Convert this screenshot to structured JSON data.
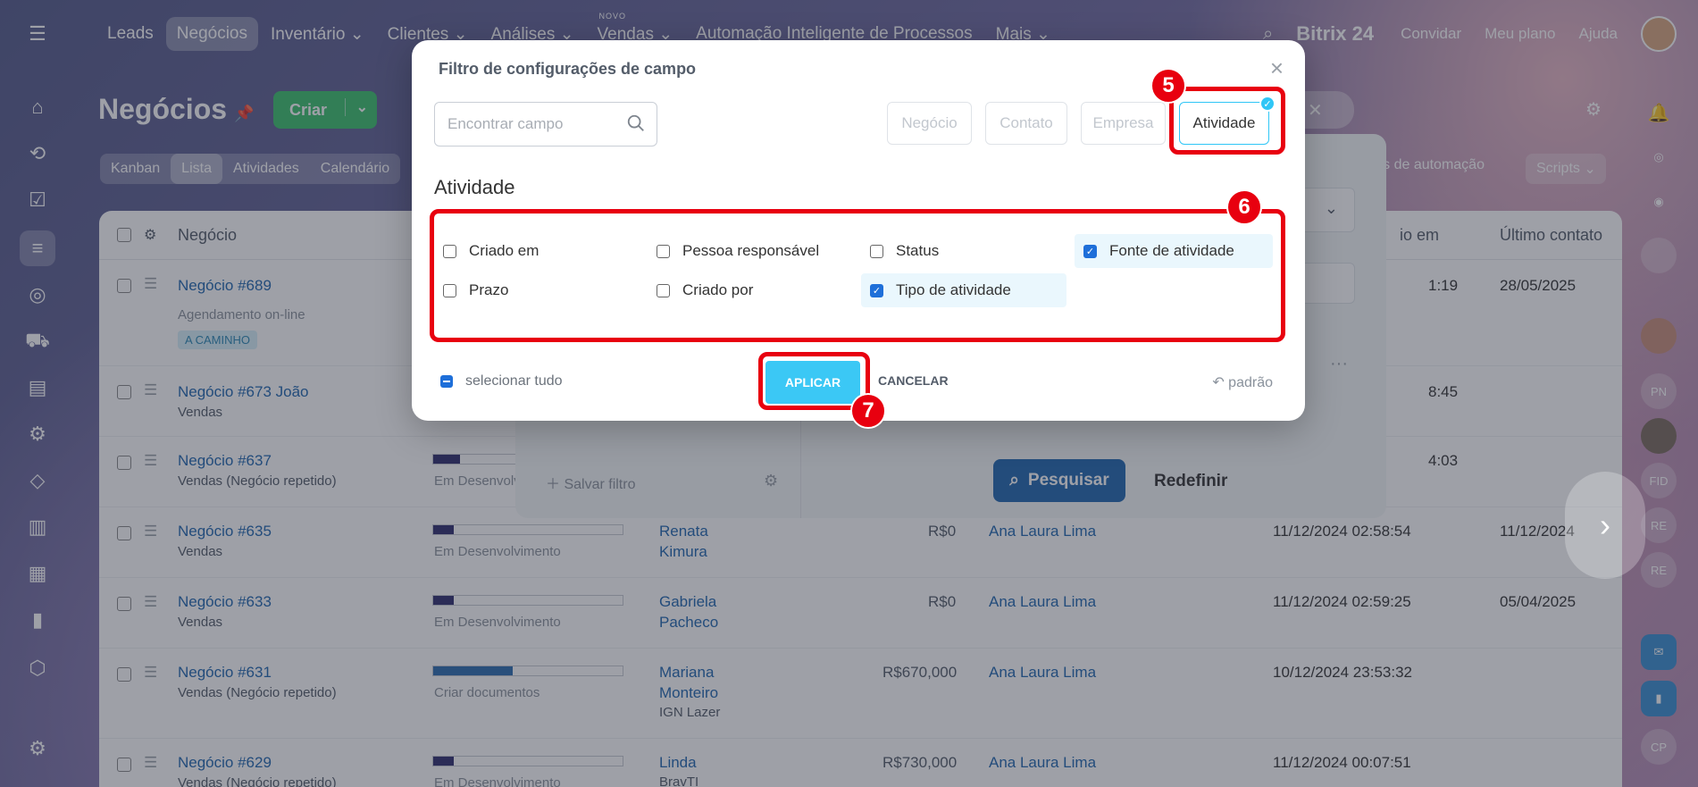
{
  "topnav": {
    "items": [
      {
        "label": "Leads",
        "active": false
      },
      {
        "label": "Negócios",
        "active": true
      },
      {
        "label": "Inventário",
        "active": false
      },
      {
        "label": "Clientes",
        "active": false
      },
      {
        "label": "Análises",
        "active": false
      },
      {
        "label": "Vendas",
        "active": false,
        "badge": "NOVO"
      },
      {
        "label": "Automação Inteligente de Processos",
        "active": false
      },
      {
        "label": "Mais",
        "active": false
      }
    ],
    "brand": "Bitrix 24",
    "invite": "Convidar",
    "plan": "Meu plano",
    "help": "Ajuda"
  },
  "page": {
    "title": "Negócios",
    "create_label": "Criar",
    "view_tabs": [
      "Kanban",
      "Lista",
      "Atividades",
      "Calendário"
    ],
    "active_view": "Lista",
    "automation_label": "gras de automação",
    "scripts_label": "Scripts"
  },
  "list": {
    "columns": [
      "Negócio",
      "io em",
      "Último contato"
    ],
    "rows": [
      {
        "title": "Negócio #689",
        "subtitle": "Agendamento on-line",
        "badge": "A CAMINHO",
        "time": "1:19",
        "last_contact": "28/05/2025"
      },
      {
        "title": "Negócio #673 João",
        "subtitle": "Vendas",
        "time": "8:45",
        "last_contact": ""
      },
      {
        "title": "Negócio #637",
        "subtitle": "Vendas (Negócio repetido)",
        "stage": "Em Desenvolvi",
        "time": "4:03",
        "last_contact": ""
      },
      {
        "title": "Negócio #635",
        "subtitle": "Vendas",
        "stage": "Em Desenvolvimento",
        "contact_line1": "Renata",
        "contact_line2": "Kimura",
        "amount": "R$0",
        "responsible": "Ana Laura Lima",
        "created": "11/12/2024 02:58:54",
        "last_contact": "11/12/2024"
      },
      {
        "title": "Negócio #633",
        "subtitle": "Vendas",
        "stage": "Em Desenvolvimento",
        "contact_line1": "Gabriela",
        "contact_line2": "Pacheco",
        "amount": "R$0",
        "responsible": "Ana Laura Lima",
        "created": "11/12/2024 02:59:25",
        "last_contact": "05/04/2025"
      },
      {
        "title": "Negócio #631",
        "subtitle": "Vendas (Negócio repetido)",
        "stage": "Criar documentos",
        "contact_line1": "Mariana",
        "contact_line2": "Monteiro",
        "contact_line3": "IGN Lazer",
        "amount": "R$670,000",
        "responsible": "Ana Laura Lima",
        "created": "10/12/2024 23:53:32",
        "last_contact": ""
      },
      {
        "title": "Negócio #629",
        "subtitle": "Vendas (Negócio repetido)",
        "stage": "Em Desenvolvimento",
        "contact_line1": "Linda",
        "contact_line2": "BravTI",
        "amount": "R$730,000",
        "responsible": "Ana Laura Lima",
        "created": "11/12/2024 00:07:51",
        "last_contact": ""
      }
    ]
  },
  "filter_panel": {
    "save_filter": "Salvar filtro",
    "search_button": "Pesquisar",
    "reset_button": "Redefinir"
  },
  "modal": {
    "title": "Filtro de configurações de campo",
    "search_placeholder": "Encontrar campo",
    "entity_buttons": [
      {
        "label": "Negócio",
        "selected": false
      },
      {
        "label": "Contato",
        "selected": false
      },
      {
        "label": "Empresa",
        "selected": false
      },
      {
        "label": "Atividade",
        "selected": true
      }
    ],
    "section_title": "Atividade",
    "fields": [
      {
        "label": "Criado em",
        "checked": false
      },
      {
        "label": "Pessoa responsável",
        "checked": false
      },
      {
        "label": "Status",
        "checked": false
      },
      {
        "label": "Fonte de atividade",
        "checked": true
      },
      {
        "label": "Prazo",
        "checked": false
      },
      {
        "label": "Criado por",
        "checked": false
      },
      {
        "label": "Tipo de atividade",
        "checked": true
      }
    ],
    "select_all": "selecionar tudo",
    "apply": "APLICAR",
    "cancel": "CANCELAR",
    "default": "padrão"
  },
  "annotations": {
    "step5": "5",
    "step6": "6",
    "step7": "7"
  },
  "right_rail": [
    "PN",
    "FID",
    "RE",
    "RE",
    "CP"
  ]
}
